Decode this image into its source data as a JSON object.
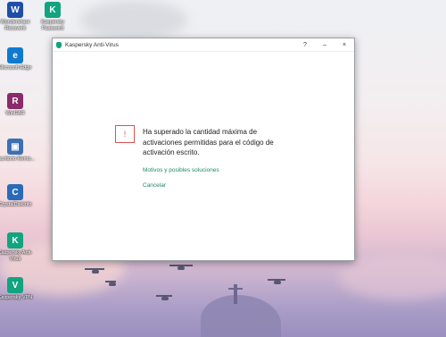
{
  "desktop": {
    "icons": [
      {
        "name": "wondershare-recoverit",
        "label": "Wondershare Recoverit",
        "glyph": "W",
        "color": "#1f4ea8"
      },
      {
        "name": "kaspersky-password",
        "label": "Kaspersky Password",
        "glyph": "K",
        "color": "#12a37f"
      },
      {
        "name": "microsoft-edge",
        "label": "Microsoft Edge",
        "glyph": "e",
        "color": "#0f7bd0"
      },
      {
        "name": "winrar",
        "label": "WinRAR",
        "glyph": "R",
        "color": "#8a2b6a"
      },
      {
        "name": "escritorio-remoto",
        "label": "Escritorio Remo...",
        "glyph": "▣",
        "color": "#3c6fb5"
      },
      {
        "name": "crystaldiskinfo",
        "label": "CrystalDiskInfo",
        "glyph": "C",
        "color": "#2a6bb8"
      },
      {
        "name": "kaspersky-antivirus",
        "label": "Kaspersky Anti-Virus",
        "glyph": "K",
        "color": "#12a37f"
      },
      {
        "name": "kaspersky-vpn",
        "label": "Kaspersky VPN",
        "glyph": "V",
        "color": "#12a37f"
      }
    ]
  },
  "window": {
    "title": "Kaspersky Anti-Virus",
    "help_label": "?",
    "minimize_label": "–",
    "close_label": "×",
    "warning_glyph": "!",
    "message": "Ha superado la cantidad máxima de activaciones permitidas para el código de activación escrito.",
    "link_reasons": "Motivos y posibles soluciones",
    "link_cancel": "Cancelar"
  }
}
